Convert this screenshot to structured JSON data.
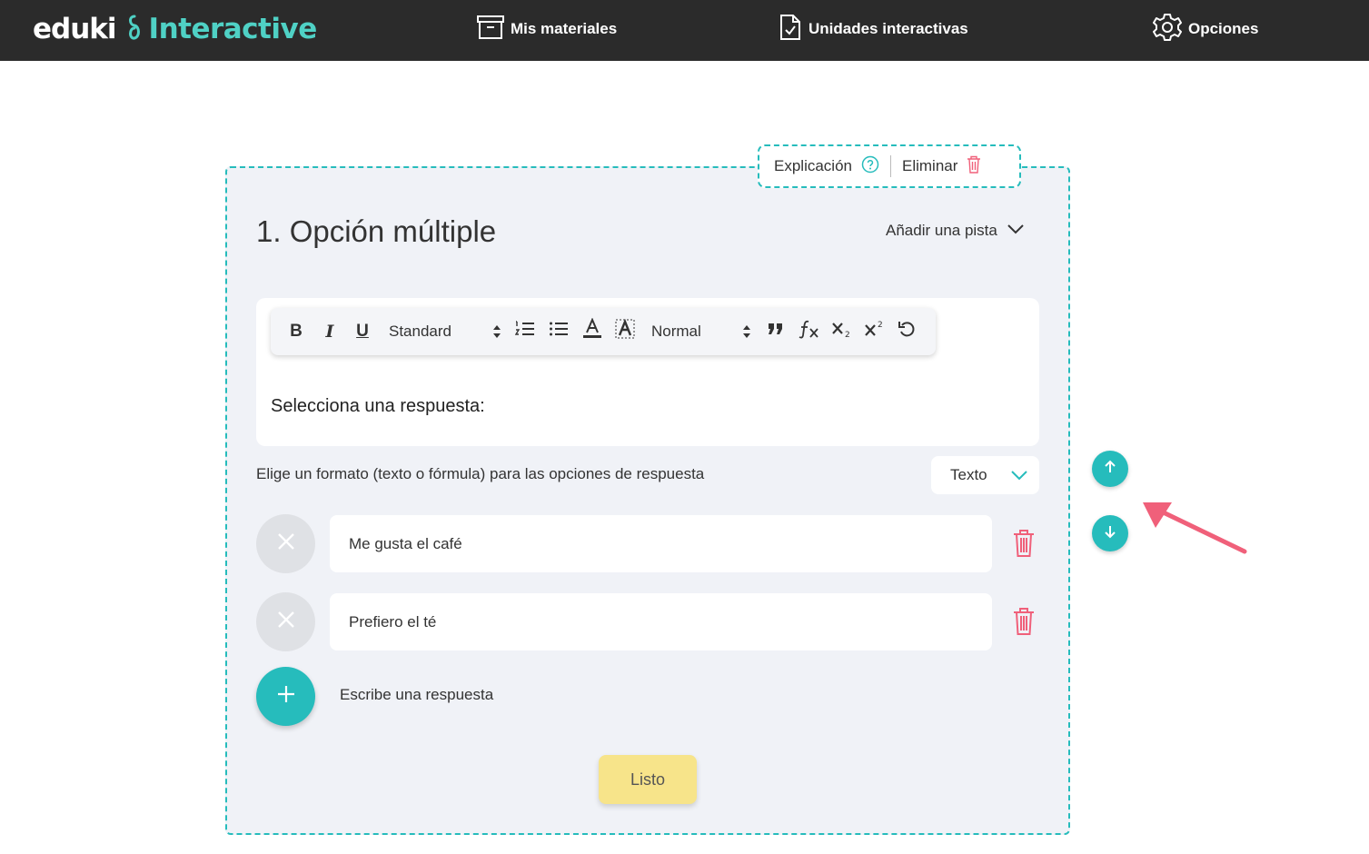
{
  "brand": {
    "name": "eduki",
    "product": "Interactive",
    "accent": "#4fd1c5"
  },
  "nav": {
    "materials": {
      "label": "Mis materiales",
      "icon": "archive-box-icon"
    },
    "units": {
      "label": "Unidades interactivas",
      "icon": "document-check-icon"
    },
    "options": {
      "label": "Opciones",
      "icon": "gear-icon"
    }
  },
  "question": {
    "actions": {
      "explanation": "Explicación",
      "delete": "Eliminar"
    },
    "title": "1. Opción múltiple",
    "hint": "Añadir una pista",
    "toolbar": {
      "font": "Standard",
      "size": "Normal"
    },
    "prompt": "Selecciona una respuesta:",
    "format_label": "Elige un formato (texto o fórmula) para las opciones de respuesta",
    "format_value": "Texto",
    "answers": [
      {
        "text": "Me gusta el café"
      },
      {
        "text": "Prefiero el té"
      }
    ],
    "add_answer": "Escribe una respuesta",
    "done": "Listo"
  },
  "colors": {
    "teal": "#26bcbc",
    "danger": "#f0607a",
    "done": "#f7e48a",
    "topbar": "#2b2b2b"
  }
}
